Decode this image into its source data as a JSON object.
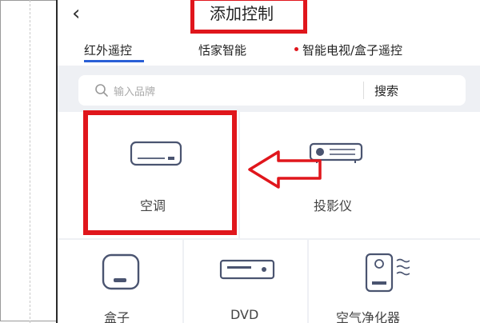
{
  "header": {
    "back_icon": "back-arrow-icon",
    "title": "添加控制"
  },
  "tabs": [
    {
      "label": "红外遥控",
      "active": true
    },
    {
      "label": "恬家智能"
    },
    {
      "label": "智能电视/盒子遥控"
    }
  ],
  "search": {
    "placeholder": "输入品牌",
    "button": "搜索"
  },
  "devices": [
    {
      "label": "空调",
      "icon": "air-conditioner-icon"
    },
    {
      "label": "投影仪",
      "icon": "projector-icon"
    },
    {
      "label": "盒子",
      "icon": "box-icon"
    },
    {
      "label": "DVD",
      "icon": "dvd-icon"
    },
    {
      "label": "空气净化器",
      "icon": "air-purifier-icon"
    }
  ],
  "colors": {
    "highlight": "#e0161c",
    "accent": "#2a5fd6",
    "icon": "#4a5470"
  }
}
